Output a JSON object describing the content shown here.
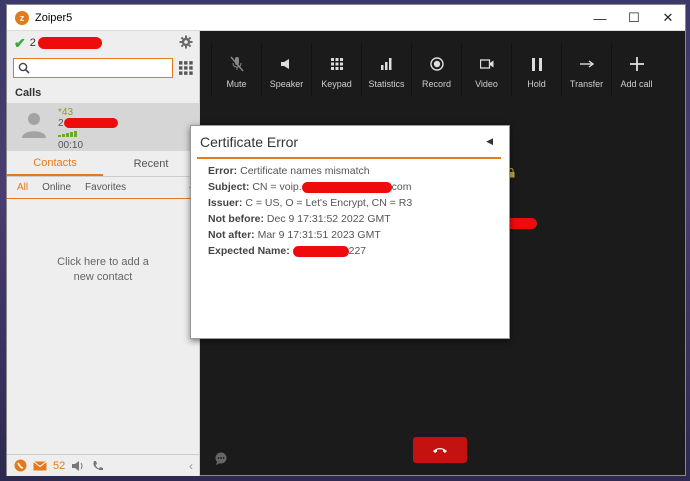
{
  "window": {
    "title": "Zoiper5"
  },
  "account": {
    "prefix": "2"
  },
  "search": {
    "placeholder": "",
    "value": ""
  },
  "calls": {
    "heading": "Calls",
    "items": [
      {
        "number_prefix": "*43",
        "line2_prefix": "2",
        "duration": "00:10"
      }
    ]
  },
  "tabs": {
    "contacts": "Contacts",
    "recent": "Recent"
  },
  "filters": {
    "all": "All",
    "online": "Online",
    "favorites": "Favorites"
  },
  "empty_hint": "Click here to add a new contact",
  "bottom_bar": {
    "message_count": "52"
  },
  "toolbar": [
    {
      "label": "Mute",
      "icon": "mic-off-icon"
    },
    {
      "label": "Speaker",
      "icon": "speaker-icon"
    },
    {
      "label": "Keypad",
      "icon": "keypad-icon"
    },
    {
      "label": "Statistics",
      "icon": "statistics-icon"
    },
    {
      "label": "Record",
      "icon": "record-icon"
    },
    {
      "label": "Video",
      "icon": "video-icon"
    },
    {
      "label": "Hold",
      "icon": "pause-icon"
    },
    {
      "label": "Transfer",
      "icon": "transfer-icon"
    },
    {
      "label": "Add call",
      "icon": "plus-icon"
    }
  ],
  "dialog": {
    "title": "Certificate Error",
    "error_label": "Error:",
    "error_value": "Certificate names mismatch",
    "subject_label": "Subject:",
    "subject_value_prefix": "CN = voip.",
    "subject_value_suffix": "com",
    "issuer_label": "Issuer:",
    "issuer_value": "C = US, O = Let's Encrypt, CN = R3",
    "not_before_label": "Not before:",
    "not_before_value": "Dec 9 17:31:52 2022 GMT",
    "not_after_label": "Not after:",
    "not_after_value": "Mar 9 17:31:51 2023 GMT",
    "expected_label": "Expected Name:",
    "expected_suffix": "227"
  },
  "colors": {
    "accent": "#e47a1c",
    "hangup": "#c3120f",
    "redaction": "#ee0b0b",
    "status_ok": "#3aa93a"
  }
}
